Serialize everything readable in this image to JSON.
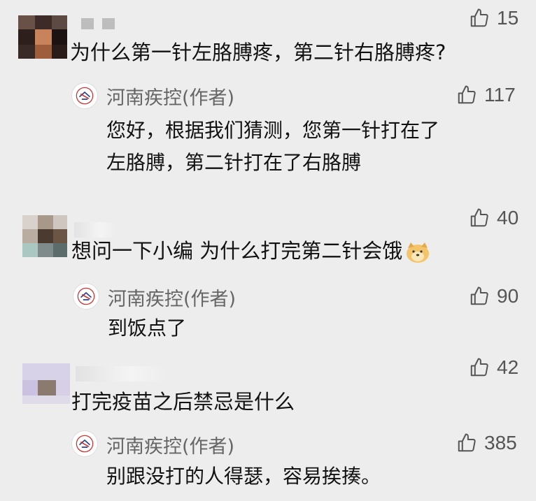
{
  "threads": [
    {
      "comment": "为什么第一针左胳膊疼，第二针右胳膊疼?",
      "likes": "15",
      "reply_author": "河南疾控(作者)",
      "reply_likes": "117",
      "reply_lines": [
        "您好，根据我们猜测，您第一针打在了",
        "左胳膊，第二针打在了右胳膊"
      ]
    },
    {
      "comment": "想问一下小编 为什么打完第二针会饿",
      "likes": "40",
      "reply_author": "河南疾控(作者)",
      "reply_likes": "90",
      "reply_lines": [
        "到饭点了"
      ]
    },
    {
      "comment": "打完疫苗之后禁忌是什么",
      "likes": "42",
      "reply_author": "河南疾控(作者)",
      "reply_likes": "385",
      "reply_lines": [
        "别跟没打的人得瑟，容易挨揍。"
      ]
    }
  ],
  "icons": {
    "like": "thumbs-up-icon",
    "author_logo": "henan-cdc-logo-icon",
    "emoji": "doge-emoji-icon"
  },
  "colors": {
    "background": "#ededed",
    "meta_text": "#666666",
    "body_text": "#111111"
  }
}
